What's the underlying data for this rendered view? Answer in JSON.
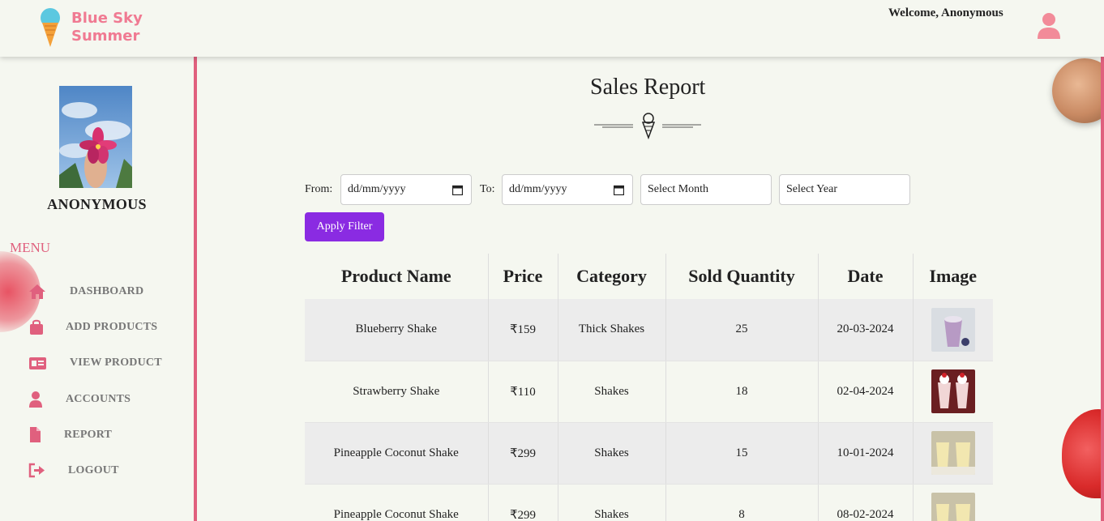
{
  "header": {
    "brand_line1": "Blue Sky",
    "brand_line2": "Summer",
    "welcome": "Welcome, Anonymous"
  },
  "sidebar": {
    "profile_name": "ANONYMOUS",
    "menu_label": "MENU",
    "items": [
      {
        "label": "DASHBOARD",
        "icon": "home-icon"
      },
      {
        "label": "ADD PRODUCTS",
        "icon": "bag-icon"
      },
      {
        "label": "VIEW PRODUCT",
        "icon": "id-card-icon"
      },
      {
        "label": "ACCOUNTS",
        "icon": "user-icon"
      },
      {
        "label": "REPORT",
        "icon": "file-icon"
      },
      {
        "label": "LOGOUT",
        "icon": "logout-icon"
      }
    ]
  },
  "main": {
    "title": "Sales Report",
    "filters": {
      "from_label": "From:",
      "from_value": "dd/mm/yyyy",
      "to_label": "To:",
      "to_value": "dd/mm/yyyy",
      "month_placeholder": "Select Month",
      "year_placeholder": "Select Year",
      "apply_label": "Apply Filter"
    },
    "table": {
      "columns": [
        "Product Name",
        "Price",
        "Category",
        "Sold Quantity",
        "Date",
        "Image"
      ],
      "rows": [
        {
          "name": "Blueberry Shake",
          "price": "₹159",
          "category": "Thick Shakes",
          "qty": "25",
          "date": "20-03-2024"
        },
        {
          "name": "Strawberry Shake",
          "price": "₹110",
          "category": "Shakes",
          "qty": "18",
          "date": "02-04-2024"
        },
        {
          "name": "Pineapple Coconut Shake",
          "price": "₹299",
          "category": "Shakes",
          "qty": "15",
          "date": "10-01-2024"
        },
        {
          "name": "Pineapple Coconut Shake",
          "price": "₹299",
          "category": "Shakes",
          "qty": "8",
          "date": "08-02-2024"
        }
      ]
    }
  },
  "colors": {
    "accent": "#e0607e",
    "brand": "#f07a92",
    "button": "#8a2be2"
  }
}
